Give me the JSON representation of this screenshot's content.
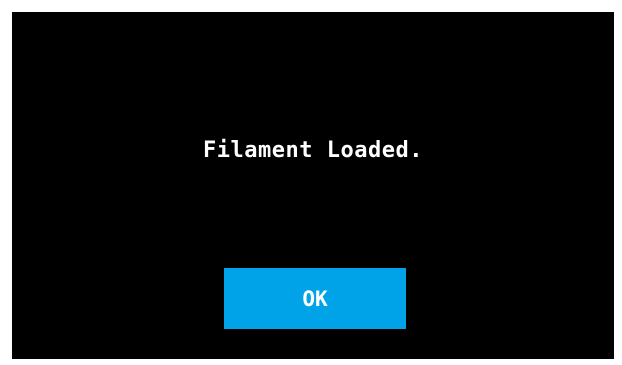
{
  "dialog": {
    "message": "Filament Loaded.",
    "ok_label": "OK"
  },
  "colors": {
    "background": "#000000",
    "button": "#00a2e8",
    "text": "#ffffff"
  }
}
